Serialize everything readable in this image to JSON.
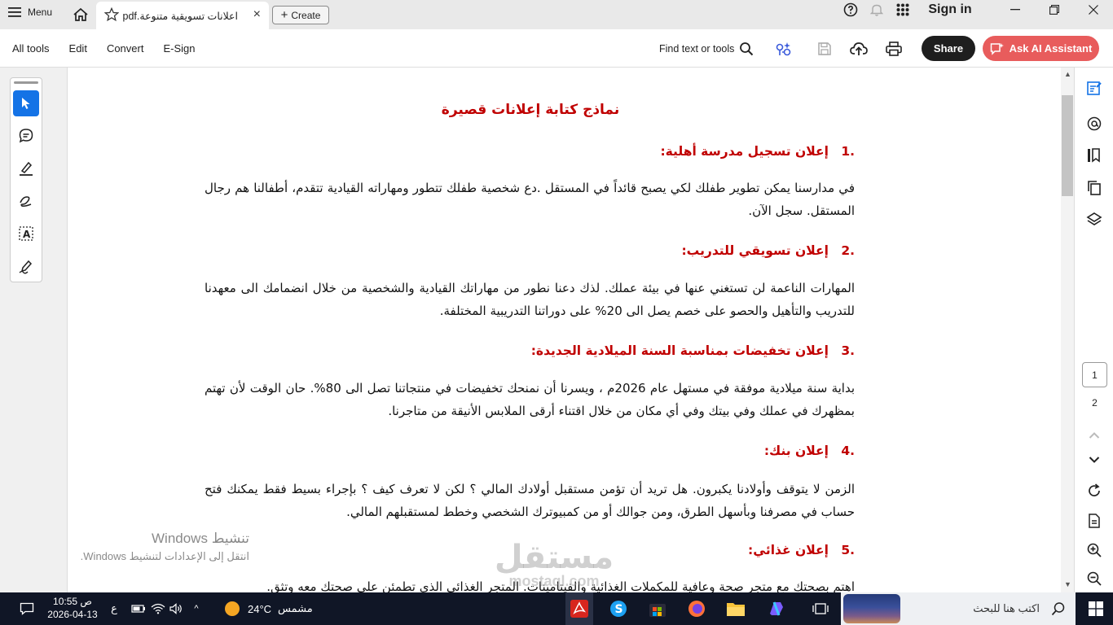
{
  "titlebar": {
    "menu_label": "Menu",
    "tab_title": "اعلانات تسويقية متنوعة.pdf",
    "tab_close": "×",
    "create_label": "Create",
    "sign_in": "Sign in"
  },
  "toolbar": {
    "nav": [
      "All tools",
      "Edit",
      "Convert",
      "E-Sign"
    ],
    "find_label": "Find text or tools",
    "share_label": "Share",
    "ai_label": "Ask AI Assistant"
  },
  "document": {
    "title": "نماذج كتابة إعلانات قصيرة",
    "sections": [
      {
        "number": ".1",
        "heading": "إعلان تسجيل مدرسة أهلية:",
        "body": "في مدارسنا يمكن تطوير طفلك لكي يصبح قائداً في المستقل .دع شخصية طفلك تتطور ومهاراته القيادية تتقدم، أطفالنا هم رجال المستقل. سجل الآن."
      },
      {
        "number": ".2",
        "heading": "إعلان تسويقي للتدريب:",
        "body": "المهارات الناعمة لن تستغني عنها في بيئة عملك. لذك دعنا نطور من مهاراتك القيادية والشخصية من خلال انضمامك الى معهدنا للتدريب والتأهيل والحصو على خصم يصل الى 20% على دوراتنا التدريبية المختلفة."
      },
      {
        "number": ".3",
        "heading": "إعلان تخفيضات بمناسبة السنة الميلادية الجديدة:",
        "body": "بداية سنة ميلادية موفقة في مستهل عام 2026م ، ويسرنا أن نمنحك تخفيضات في منتجاتنا تصل الى 80%. حان الوقت لأن تهتم بمظهرك في عملك وفي بيتك وفي أي مكان من خلال اقتناء أرقى الملابس الأنيقة من متاجرنا."
      },
      {
        "number": ".4",
        "heading": "إعلان بنك:",
        "body": "الزمن لا يتوقف وأولادنا يكبرون. هل تريد أن تؤمن مستقبل أولادك المالي ؟ لكن لا تعرف كيف ؟ بإجراء بسيط فقط يمكنك فتح حساب في مصرفنا وبأسهل الطرق، ومن جوالك أو من كمبيوترك الشخصي وخطط لمستقبلهم المالي."
      },
      {
        "number": ".5",
        "heading": "إعلان غذائي:",
        "body": "اهتم بصحتك مع متجر صحة وعافية للمكملات الغذائية والفيتامينات. المتجر الغذائي الذي تطمئن على صحتك معه وتثق."
      }
    ]
  },
  "pager": {
    "current": "1",
    "next": "2"
  },
  "watermark": {
    "activate_title": "تنشيط Windows",
    "activate_sub": "انتقل إلى الإعدادات لتنشيط Windows.",
    "brand_ar": "مستقل",
    "brand_en": "mostaql.com"
  },
  "taskbar": {
    "search_placeholder": "اكتب هنا للبحث",
    "weather_temp": "24°C",
    "weather_desc": "مشمس",
    "time": "10:55",
    "ampm": "ص",
    "date": "2026-04-13",
    "lang": "ع"
  },
  "colors": {
    "heading_red": "#c00000",
    "accent_blue": "#1473e6",
    "ai_button": "#e85c5c",
    "share_button": "#1e1e1e",
    "taskbar": "#101626"
  }
}
